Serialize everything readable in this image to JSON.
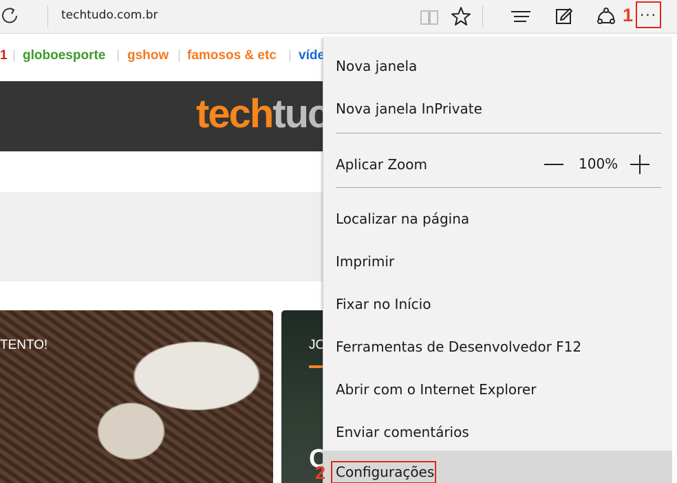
{
  "browser": {
    "url": "techtudo.com.br",
    "annotation_1": "1",
    "more_label": "···"
  },
  "page": {
    "nav_links": [
      {
        "text": "1",
        "color": "#cc1f1f"
      },
      {
        "text": "globoesporte",
        "color": "#3c9a2b"
      },
      {
        "text": "gshow",
        "color": "#f47920"
      },
      {
        "text": "famosos & etc",
        "color": "#f47920"
      },
      {
        "text": "víde",
        "color": "#1a66d6"
      }
    ],
    "logo_part1": "tech",
    "logo_part2": "tuc",
    "card1_text": "TENTO!",
    "card2_text": "JO",
    "card2_big_letter": "C"
  },
  "menu": {
    "items": [
      {
        "label": "Nova janela"
      },
      {
        "label": "Nova janela InPrivate"
      },
      {
        "label": "Aplicar Zoom"
      },
      {
        "label": "Localizar na página"
      },
      {
        "label": "Imprimir"
      },
      {
        "label": "Fixar no Início"
      },
      {
        "label": "Ferramentas de Desenvolvedor F12"
      },
      {
        "label": "Abrir com o Internet Explorer"
      },
      {
        "label": "Enviar comentários"
      },
      {
        "label": "Configurações"
      }
    ],
    "zoom_value": "100%",
    "annotation_2": "2"
  },
  "colors": {
    "annotation_red": "#e0271e",
    "techtudo_orange": "#f7861c"
  }
}
